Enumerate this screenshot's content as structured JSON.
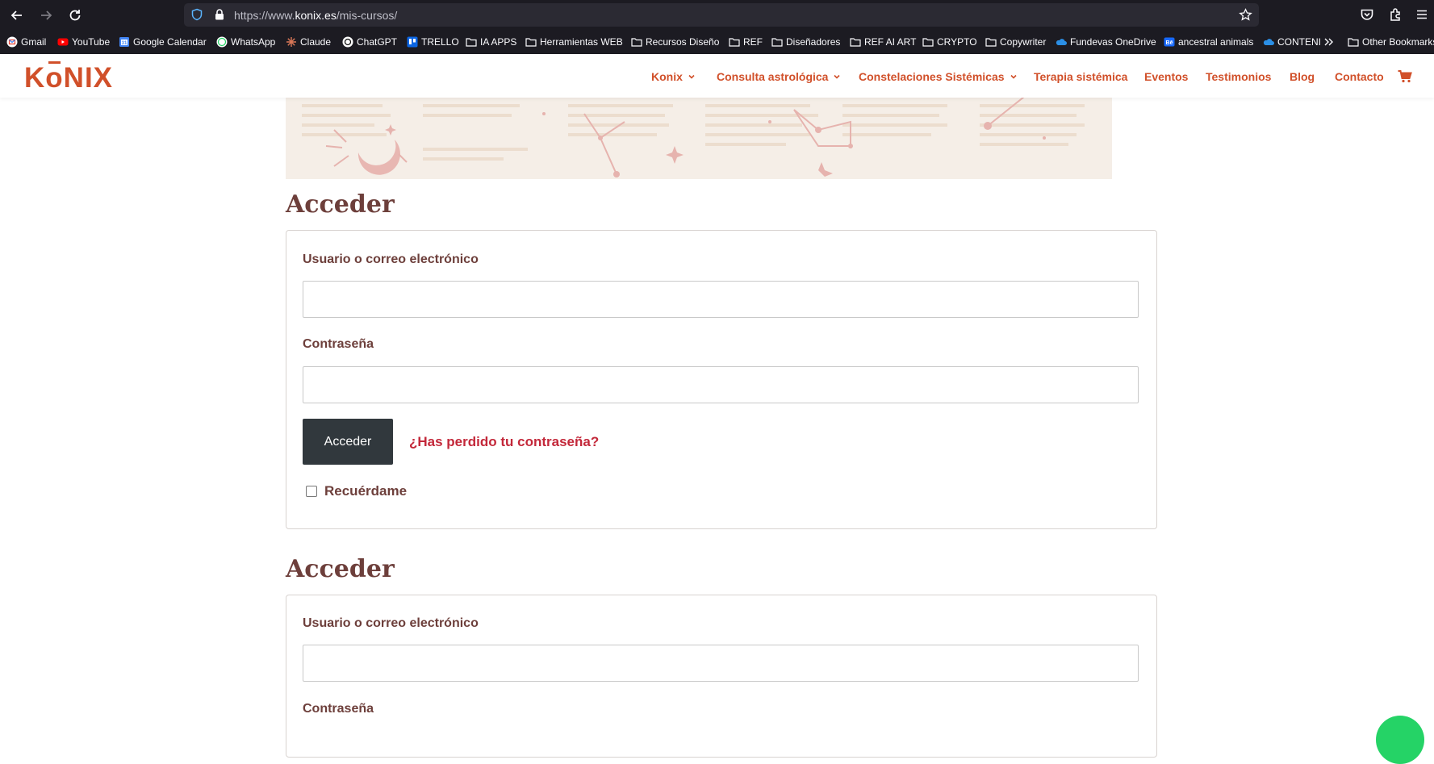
{
  "browser": {
    "url_prefix": "https://www.",
    "url_domain": "konix.es",
    "url_path": "/mis-cursos/",
    "bookmarks": [
      {
        "label": "Gmail",
        "icon": "gmail-icon"
      },
      {
        "label": "YouTube",
        "icon": "youtube-icon"
      },
      {
        "label": "Google Calendar",
        "icon": "calendar-icon"
      },
      {
        "label": "WhatsApp",
        "icon": "whatsapp-icon"
      },
      {
        "label": "Claude",
        "icon": "claude-icon"
      },
      {
        "label": "ChatGPT",
        "icon": "chatgpt-icon"
      },
      {
        "label": "TRELLO",
        "icon": "trello-icon"
      },
      {
        "label": "IA APPS",
        "icon": "folder-icon"
      },
      {
        "label": "Herramientas WEB",
        "icon": "folder-icon"
      },
      {
        "label": "Recursos Diseño",
        "icon": "folder-icon"
      },
      {
        "label": "REF",
        "icon": "folder-icon"
      },
      {
        "label": "Diseñadores",
        "icon": "folder-icon"
      },
      {
        "label": "REF AI ART",
        "icon": "folder-icon"
      },
      {
        "label": "CRYPTO",
        "icon": "folder-icon"
      },
      {
        "label": "Copywriter",
        "icon": "folder-icon"
      },
      {
        "label": "Fundevas OneDrive",
        "icon": "onedrive-icon"
      },
      {
        "label": "ancestral animals",
        "icon": "behance-icon"
      },
      {
        "label": "CONTENI",
        "icon": "onedrive-icon"
      },
      {
        "label": "Other Bookmarks",
        "icon": "folder-icon"
      }
    ]
  },
  "site": {
    "logo": {
      "pre": "K",
      "o": "o",
      "post": "NIX"
    },
    "menu": [
      {
        "label": "Konix",
        "dropdown": true
      },
      {
        "label": "Consulta astrológica",
        "dropdown": true
      },
      {
        "label": "Constelaciones Sistémicas",
        "dropdown": true
      },
      {
        "label": "Terapia sistémica",
        "dropdown": false
      },
      {
        "label": "Eventos",
        "dropdown": false
      },
      {
        "label": "Testimonios",
        "dropdown": false
      },
      {
        "label": "Blog",
        "dropdown": false
      },
      {
        "label": "Contacto",
        "dropdown": false
      }
    ],
    "accent_color": "#d1502a"
  },
  "login_forms": [
    {
      "title": "Acceder",
      "username_label": "Usuario o correo electrónico",
      "password_label": "Contraseña",
      "submit_label": "Acceder",
      "lost_password": "¿Has perdido tu contraseña?",
      "remember_label": "Recuérdame"
    },
    {
      "title": "Acceder",
      "username_label": "Usuario o correo electrónico",
      "password_label": "Contraseña"
    }
  ]
}
